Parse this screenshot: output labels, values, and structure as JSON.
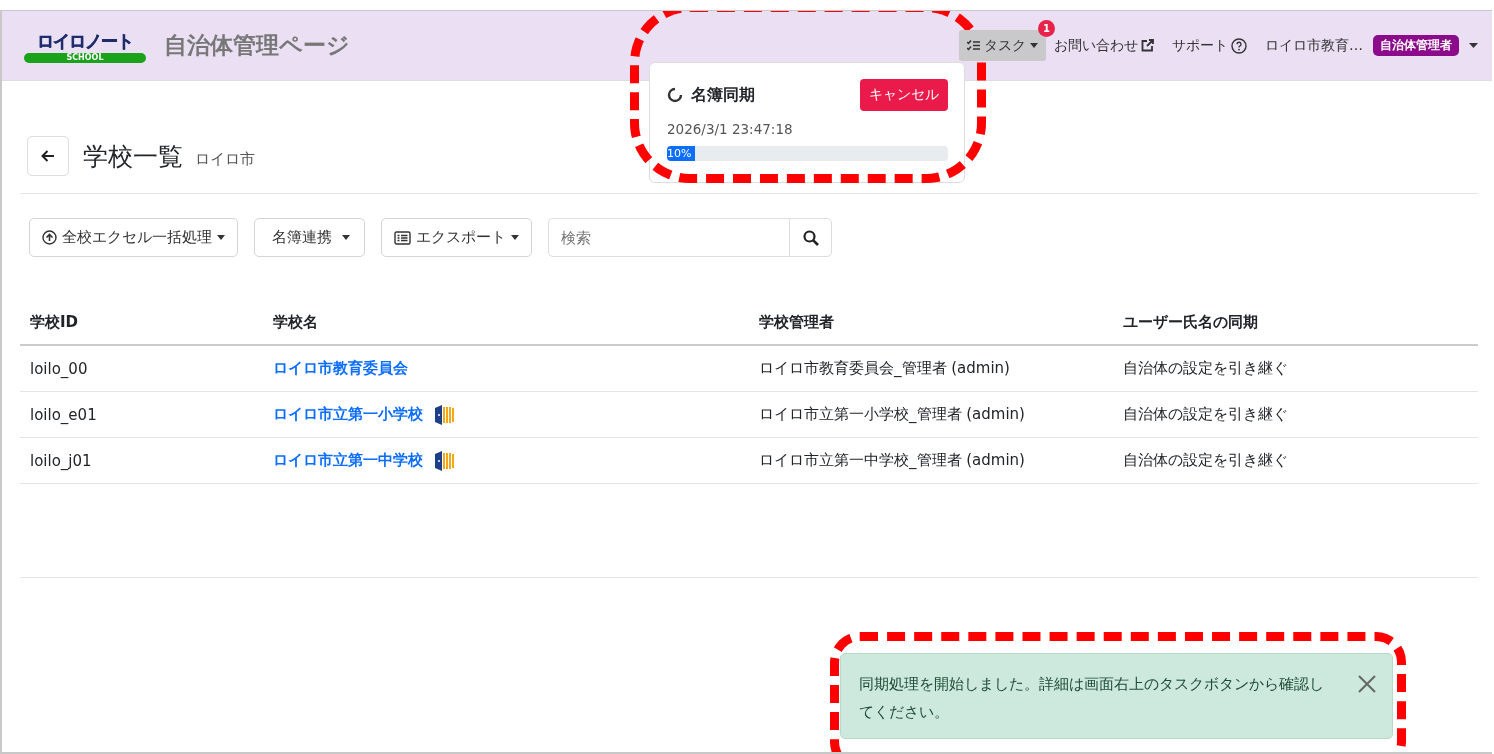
{
  "header": {
    "logo": {
      "text": "ロイロノート",
      "sub": "SCHOOL"
    },
    "title": "自治体管理ページ",
    "task_button": {
      "label": "タスク",
      "badge": "1"
    },
    "links": [
      {
        "label": "お問い合わせ",
        "kind": "external"
      },
      {
        "label": "サポート",
        "kind": "help"
      }
    ],
    "user": {
      "name": "ロイロ市教育…",
      "role": "自治体管理者"
    }
  },
  "task_panel": {
    "title": "名簿同期",
    "cancel": "キャンセル",
    "time": "2026/3/1 23:47:18",
    "level": 0.1,
    "reading": "10%"
  },
  "page": {
    "title": "学校一覧",
    "subtitle": "ロイロ市"
  },
  "toolbar": [
    {
      "label": "全校エクセル一括処理",
      "kind": "upload"
    },
    {
      "label": "名簿連携",
      "kind": "plain"
    },
    {
      "label": "エクスポート",
      "kind": "list"
    }
  ],
  "search": {
    "placeholder": "検索"
  },
  "table": {
    "columns": [
      "学校ID",
      "学校名",
      "学校管理者",
      "ユーザー氏名の同期"
    ],
    "rows": [
      {
        "id": "loilo_00",
        "name": "ロイロ市教育委員会",
        "linked": false,
        "admin": "ロイロ市教育委員会_管理者 (admin)",
        "sync": "自治体の設定を引き継ぐ"
      },
      {
        "id": "loilo_e01",
        "name": "ロイロ市立第一小学校",
        "linked": true,
        "admin": "ロイロ市立第一小学校_管理者 (admin)",
        "sync": "自治体の設定を引き継ぐ"
      },
      {
        "id": "loilo_j01",
        "name": "ロイロ市立第一中学校",
        "linked": true,
        "admin": "ロイロ市立第一中学校_管理者 (admin)",
        "sync": "自治体の設定を引き継ぐ"
      }
    ]
  },
  "toast": {
    "message": "同期処理を開始しました。詳細は画面右上のタスクボタンから確認してください。"
  }
}
